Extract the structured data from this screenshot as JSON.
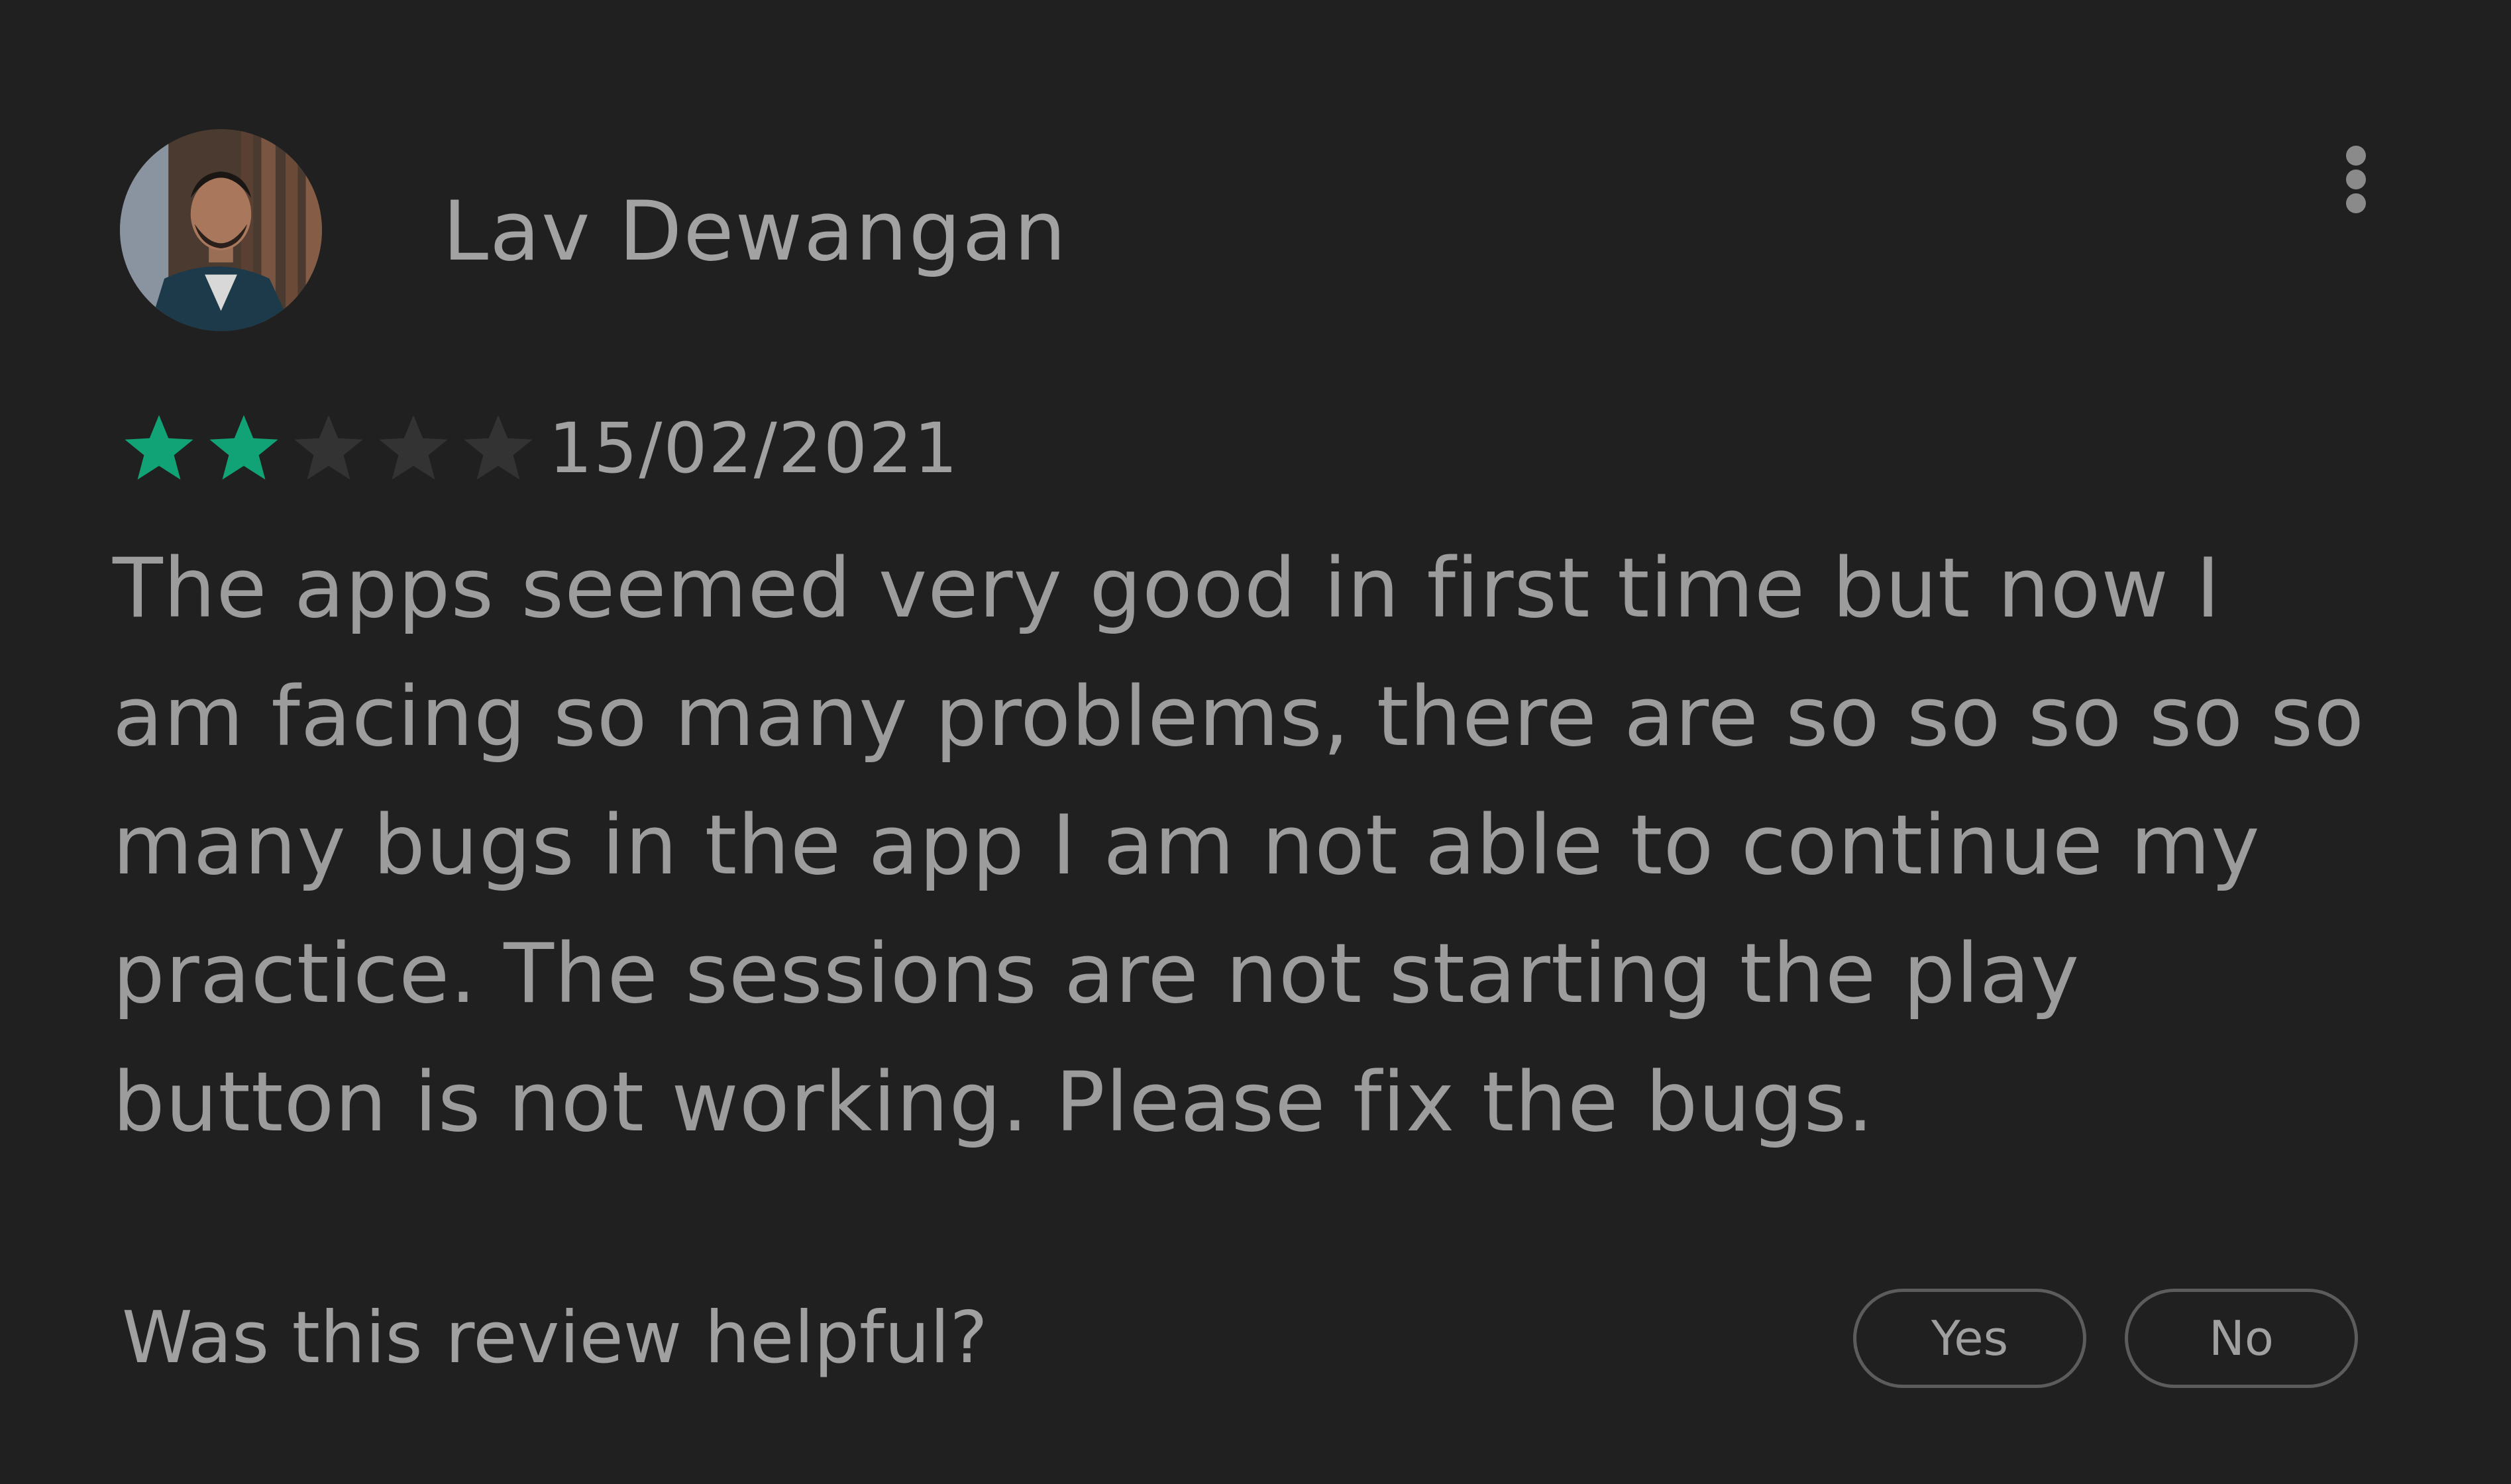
{
  "review": {
    "reviewer_name": "Lav Dewangan",
    "avatar_icon": "user-photo-avatar",
    "menu_icon": "more-vert-icon",
    "rating": 2,
    "rating_max": 5,
    "star_colors": {
      "filled": "#11a375",
      "empty": "#333333"
    },
    "date": "15/02/2021",
    "text": "The apps seemed very good in first time but now I am facing so many problems, there are so so so so so many bugs in the app I am not able to continue my practice. The sessions are not starting the play button is not working. Please fix the bugs."
  },
  "feedback": {
    "question": "Was this review helpful?",
    "yes_label": "Yes",
    "no_label": "No"
  },
  "colors": {
    "background": "#202020",
    "text": "#9c9c9c",
    "accent": "#11a375"
  }
}
